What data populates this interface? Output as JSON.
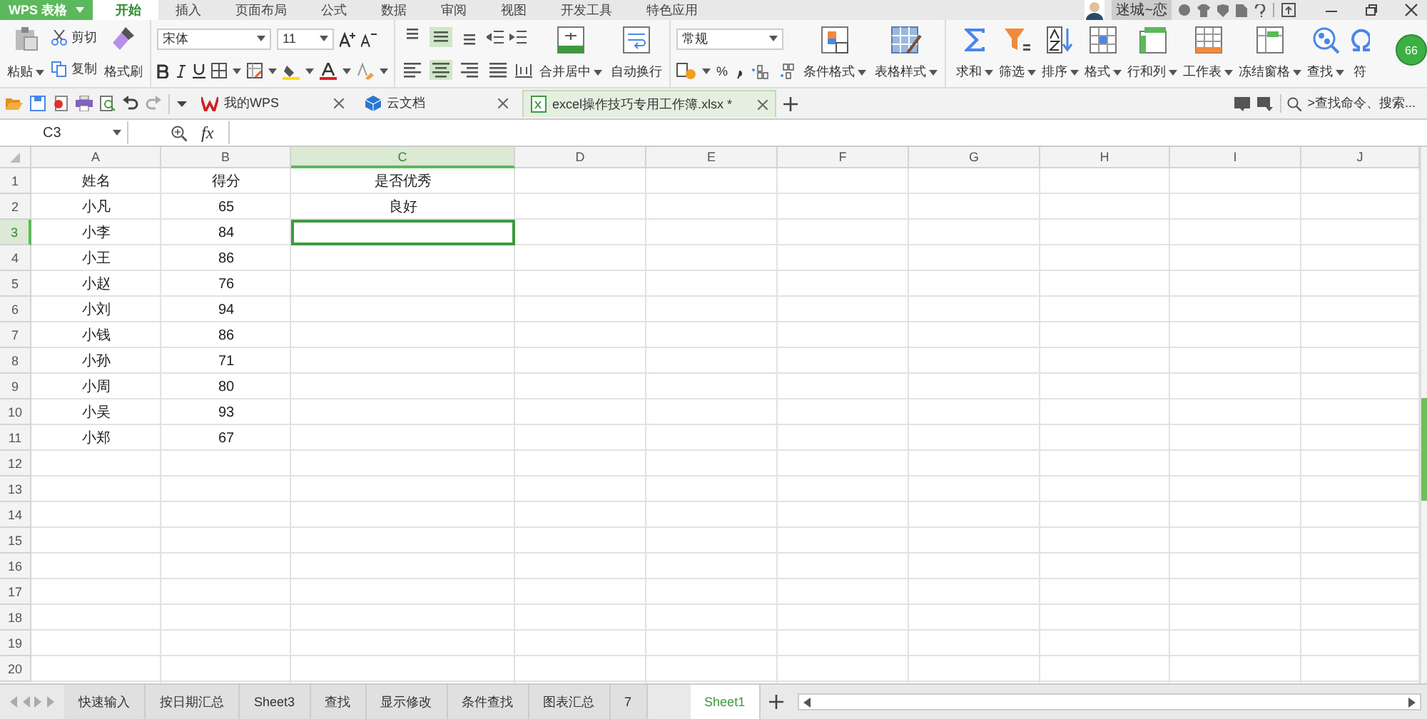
{
  "app_button": {
    "label": "WPS 表格"
  },
  "menu_tabs": [
    {
      "label": "开始",
      "selected": true
    },
    {
      "label": "插入",
      "selected": false
    },
    {
      "label": "页面布局",
      "selected": false
    },
    {
      "label": "公式",
      "selected": false
    },
    {
      "label": "数据",
      "selected": false
    },
    {
      "label": "审阅",
      "selected": false
    },
    {
      "label": "视图",
      "selected": false
    },
    {
      "label": "开发工具",
      "selected": false
    },
    {
      "label": "特色应用",
      "selected": false
    }
  ],
  "user": {
    "name": "迷城~恋"
  },
  "ribbon": {
    "paste": {
      "label": "粘贴"
    },
    "cut": {
      "label": "剪切"
    },
    "copy": {
      "label": "复制"
    },
    "format_painter": {
      "label": "格式刷"
    },
    "font_name": "宋体",
    "font_size": "11",
    "vertical_align": [
      {
        "selected": false
      },
      {
        "selected": true
      },
      {
        "selected": false
      }
    ],
    "horizontal_align": [
      {
        "selected": false
      },
      {
        "selected": true
      },
      {
        "selected": false
      },
      {
        "selected": false
      }
    ],
    "merge_buttons": [
      {
        "label": "合并居中",
        "dropdown": true
      },
      {
        "label": "自动换行",
        "dropdown": false
      }
    ],
    "number_format": "常规",
    "percent": "%",
    "style_buttons": [
      {
        "label": "条件格式",
        "dropdown": true
      },
      {
        "label": "表格样式",
        "dropdown": true
      }
    ],
    "tool_buttons": [
      {
        "label": "求和",
        "dropdown": true
      },
      {
        "label": "筛选",
        "dropdown": true
      },
      {
        "label": "排序",
        "dropdown": true
      },
      {
        "label": "格式",
        "dropdown": true
      },
      {
        "label": "行和列",
        "dropdown": true
      },
      {
        "label": "工作表",
        "dropdown": true
      },
      {
        "label": "冻结窗格",
        "dropdown": true
      },
      {
        "label": "查找",
        "dropdown": true
      },
      {
        "label": "符",
        "dropdown": false
      }
    ],
    "badge": "66"
  },
  "doc_tabs": [
    {
      "label": "我的WPS",
      "selected": false
    },
    {
      "label": "云文档",
      "selected": false
    },
    {
      "label": "excel操作技巧专用工作簿.xlsx *",
      "selected": true
    }
  ],
  "command_search": {
    "placeholder": ">查找命令、搜索..."
  },
  "formula_bar": {
    "name_box": "C3",
    "fx_label": "fx"
  },
  "grid": {
    "columns": [
      {
        "label": "A",
        "selected": false
      },
      {
        "label": "B",
        "selected": false
      },
      {
        "label": "C",
        "selected": true
      },
      {
        "label": "D",
        "selected": false
      },
      {
        "label": "E",
        "selected": false
      },
      {
        "label": "F",
        "selected": false
      },
      {
        "label": "G",
        "selected": false
      },
      {
        "label": "H",
        "selected": false
      },
      {
        "label": "I",
        "selected": false
      },
      {
        "label": "J",
        "selected": false
      }
    ],
    "rows": [
      {
        "number": "1",
        "selected": false,
        "cells": [
          "姓名",
          "得分",
          "是否优秀"
        ]
      },
      {
        "number": "2",
        "selected": false,
        "cells": [
          "小凡",
          "65",
          "良好"
        ]
      },
      {
        "number": "3",
        "selected": true,
        "cells": [
          "小李",
          "84"
        ]
      },
      {
        "number": "4",
        "selected": false,
        "cells": [
          "小王",
          "86"
        ]
      },
      {
        "number": "5",
        "selected": false,
        "cells": [
          "小赵",
          "76"
        ]
      },
      {
        "number": "6",
        "selected": false,
        "cells": [
          "小刘",
          "94"
        ]
      },
      {
        "number": "7",
        "selected": false,
        "cells": [
          "小钱",
          "86"
        ]
      },
      {
        "number": "8",
        "selected": false,
        "cells": [
          "小孙",
          "71"
        ]
      },
      {
        "number": "9",
        "selected": false,
        "cells": [
          "小周",
          "80"
        ]
      },
      {
        "number": "10",
        "selected": false,
        "cells": [
          "小吴",
          "93"
        ]
      },
      {
        "number": "11",
        "selected": false,
        "cells": [
          "小郑",
          "67"
        ]
      },
      {
        "number": "12",
        "selected": false
      },
      {
        "number": "13",
        "selected": false
      },
      {
        "number": "14",
        "selected": false
      },
      {
        "number": "15",
        "selected": false
      },
      {
        "number": "16",
        "selected": false
      },
      {
        "number": "17",
        "selected": false
      },
      {
        "number": "18",
        "selected": false
      },
      {
        "number": "19",
        "selected": false
      },
      {
        "number": "20",
        "selected": false
      }
    ]
  },
  "sheet_tabs": [
    {
      "label": "快速输入",
      "selected": false
    },
    {
      "label": "按日期汇总",
      "selected": false
    },
    {
      "label": "Sheet3",
      "selected": false
    },
    {
      "label": "查找",
      "selected": false
    },
    {
      "label": "显示修改",
      "selected": false
    },
    {
      "label": "条件查找",
      "selected": false
    },
    {
      "label": "图表汇总",
      "selected": false
    },
    {
      "label": "7",
      "selected": false
    },
    {
      "label": "Sheet1",
      "selected": true
    }
  ]
}
